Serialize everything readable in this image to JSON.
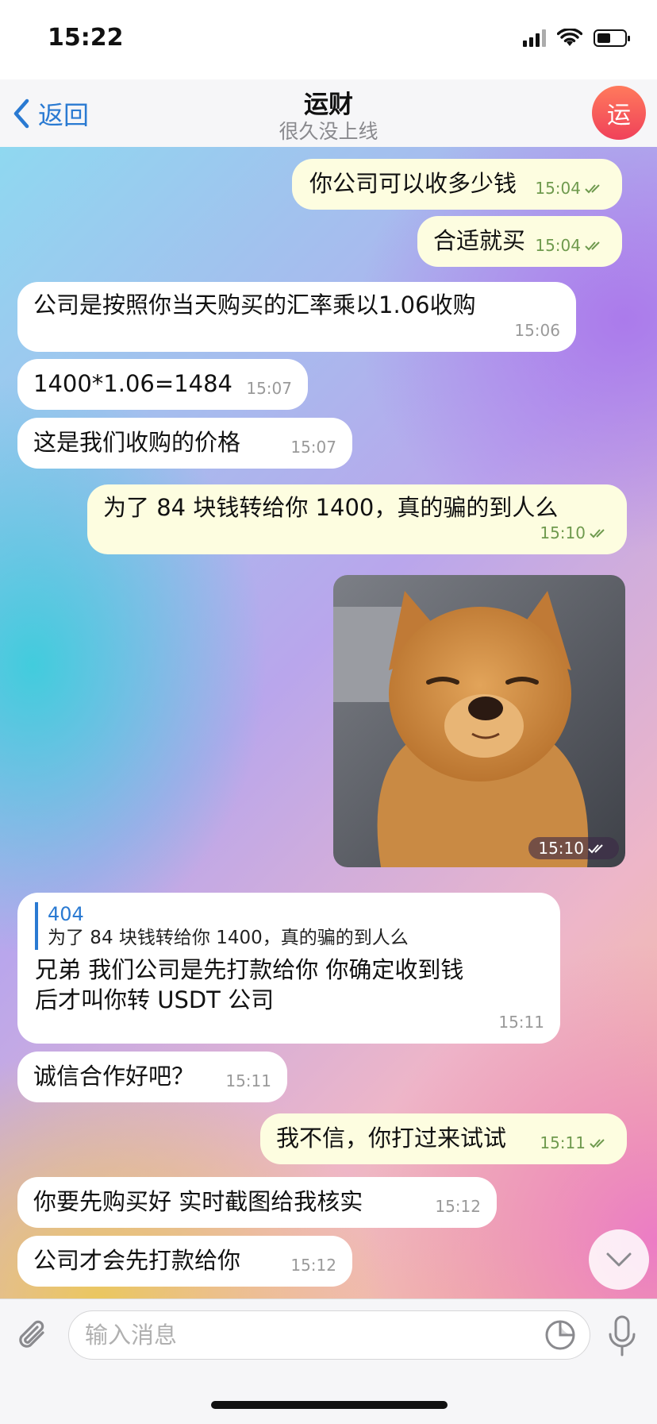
{
  "status_bar": {
    "time": "15:22"
  },
  "nav": {
    "back_label": "返回",
    "title": "运财",
    "subtitle": "很久没上线",
    "avatar_letter": "运"
  },
  "messages": [
    {
      "text": "你公司可以收多少钱",
      "time": "15:04"
    },
    {
      "text": "合适就买",
      "time": "15:04"
    },
    {
      "text": "公司是按照你当天购买的汇率乘以1.06收购",
      "time": "15:06"
    },
    {
      "text": "1400*1.06=1484",
      "time": "15:07"
    },
    {
      "text": "这是我们收购的价格",
      "time": "15:07"
    },
    {
      "text": "为了 84 块钱转给你 1400，真的骗的到人么",
      "time": "15:10"
    },
    {
      "photo_time": "15:10"
    },
    {
      "reply_name": "404",
      "reply_text": "为了 84 块钱转给你 1400，真的骗的到人么",
      "line1": "兄弟 我们公司是先打款给你 你确定收到钱",
      "line2": "后才叫你转 USDT 公司",
      "time": "15:11"
    },
    {
      "text": "诚信合作好吧？",
      "time": "15:11"
    },
    {
      "text": "我不信，你打过来试试",
      "time": "15:11"
    },
    {
      "text": "你要先购买好 实时截图给我核实",
      "time": "15:12"
    },
    {
      "text": "公司才会先打款给你",
      "time": "15:12"
    }
  ],
  "input": {
    "placeholder": "输入消息"
  },
  "colors": {
    "accent": "#2a7ad2",
    "outgoing_bubble": "#fdfde0",
    "incoming_bubble": "#ffffff"
  },
  "icons": [
    "back-chevron-icon",
    "paperclip-icon",
    "sticker-icon",
    "microphone-icon",
    "chevron-down-icon",
    "double-check-icon"
  ]
}
